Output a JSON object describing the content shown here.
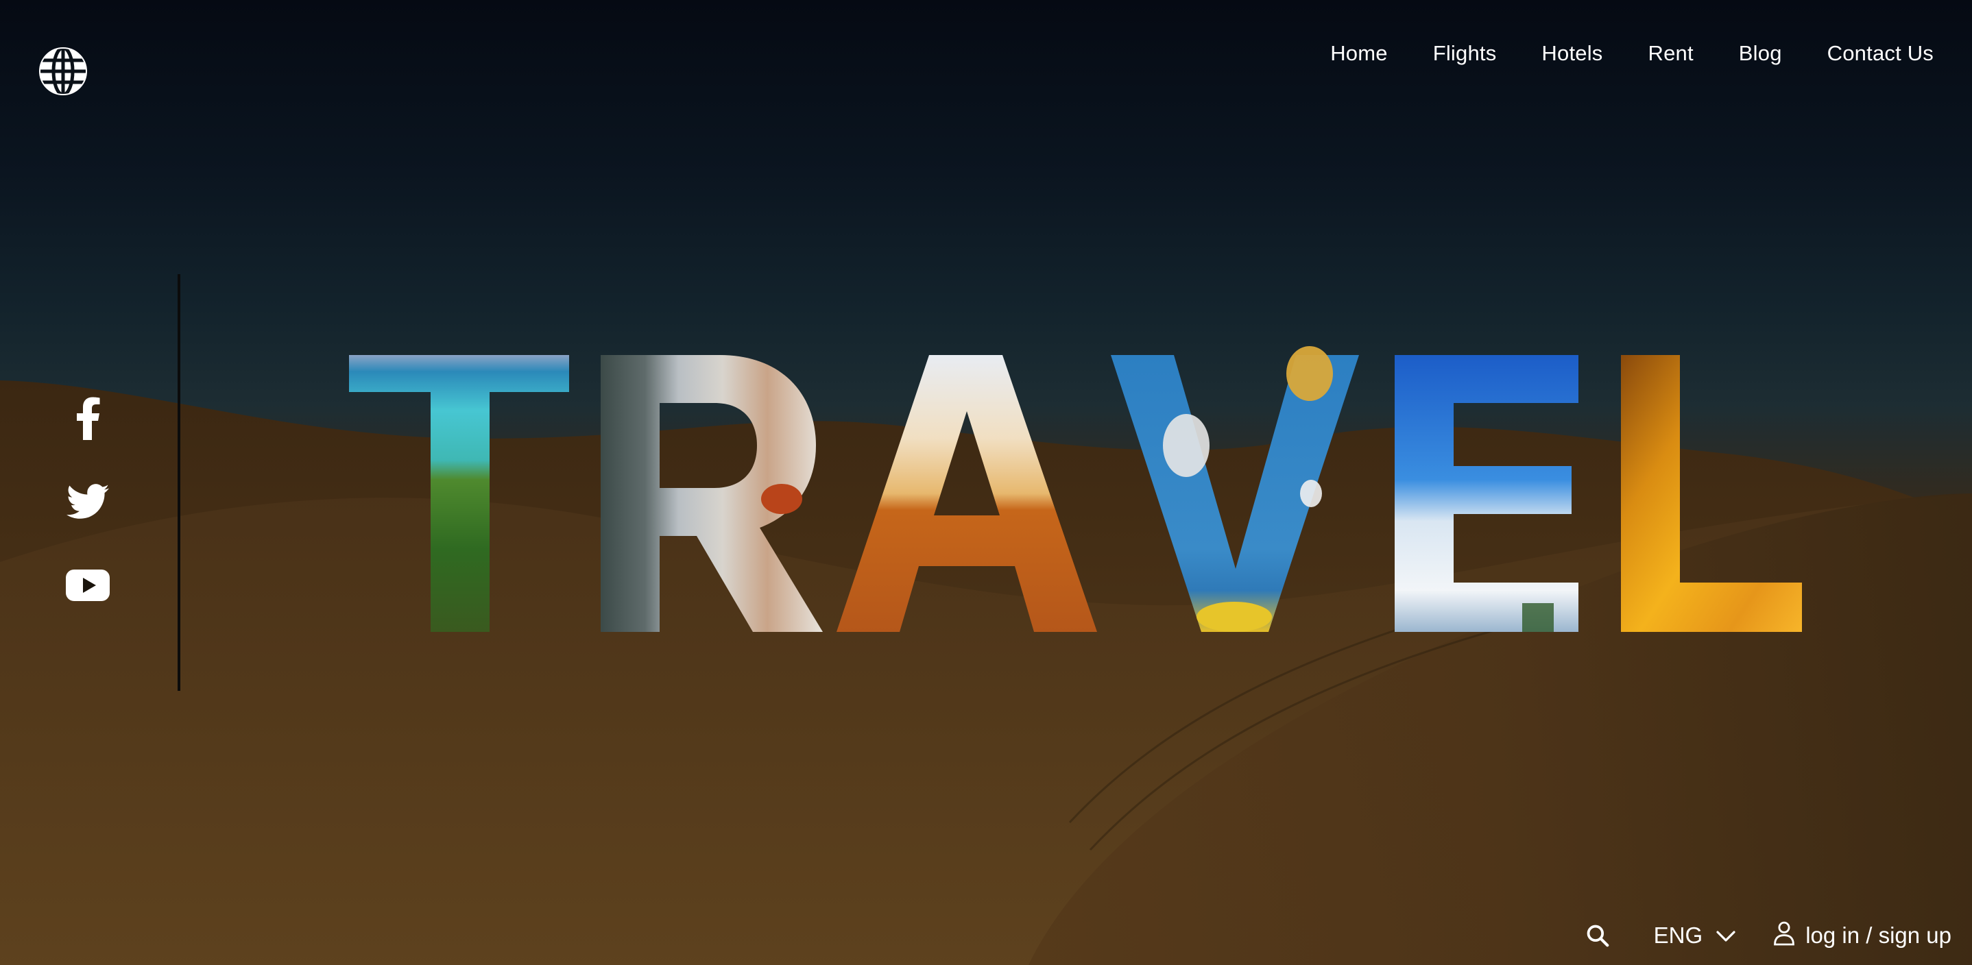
{
  "brand": {
    "logo_icon": "globe-icon"
  },
  "nav": {
    "items": [
      {
        "label": "Home"
      },
      {
        "label": "Flights"
      },
      {
        "label": "Hotels"
      },
      {
        "label": "Rent"
      },
      {
        "label": "Blog"
      },
      {
        "label": "Contact Us"
      }
    ]
  },
  "social": {
    "icons": [
      "facebook-icon",
      "twitter-icon",
      "youtube-icon"
    ]
  },
  "hero": {
    "word": "TRAVEL"
  },
  "bottom_bar": {
    "search_icon": "search-icon",
    "language": "ENG",
    "language_icon": "chevron-down-icon",
    "login_icon": "user-icon",
    "login_label": "log in / sign up"
  },
  "colors": {
    "text": "#ffffff",
    "sky_top": "#050a13",
    "sand": "#5a3e1c",
    "ocean": "#3fc3c9",
    "sky_blue": "#2b7fce",
    "desert_orange": "#c8661c",
    "sunset_gold": "#e9a21f"
  }
}
